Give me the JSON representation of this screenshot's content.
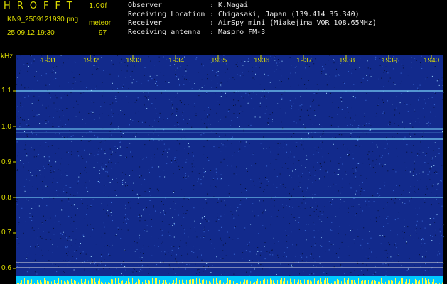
{
  "header": {
    "app_title": "HROFFT",
    "version": "1.00f",
    "filename": "KN9_2509121930.png",
    "mode": "meteor",
    "datetime": "25.09.12 19:30",
    "count": "97"
  },
  "station_info": [
    {
      "key": "Observer",
      "sep": ":",
      "value": "K.Nagai"
    },
    {
      "key": "Receiving Location",
      "sep": ":",
      "value": "Chigasaki, Japan (139.414 35.340)"
    },
    {
      "key": "Receiver",
      "sep": ":",
      "value": "AirSpy mini (Miakejima VOR 108.65MHz)"
    },
    {
      "key": "Receiving antenna",
      "sep": ":",
      "value": "Maspro FM-3"
    }
  ],
  "plot": {
    "unit": "kHz",
    "y_ticks": [
      "1.1",
      "1.0",
      "0.9",
      "0.8",
      "0.7",
      "0.6"
    ],
    "x_ticks": [
      "1931",
      "1932",
      "1933",
      "1934",
      "1935",
      "1936",
      "1937",
      "1938",
      "1939",
      "1940"
    ],
    "colors": {
      "background": "#122a8c",
      "signal": "#80e0ff",
      "axis": "#dede00"
    }
  }
}
